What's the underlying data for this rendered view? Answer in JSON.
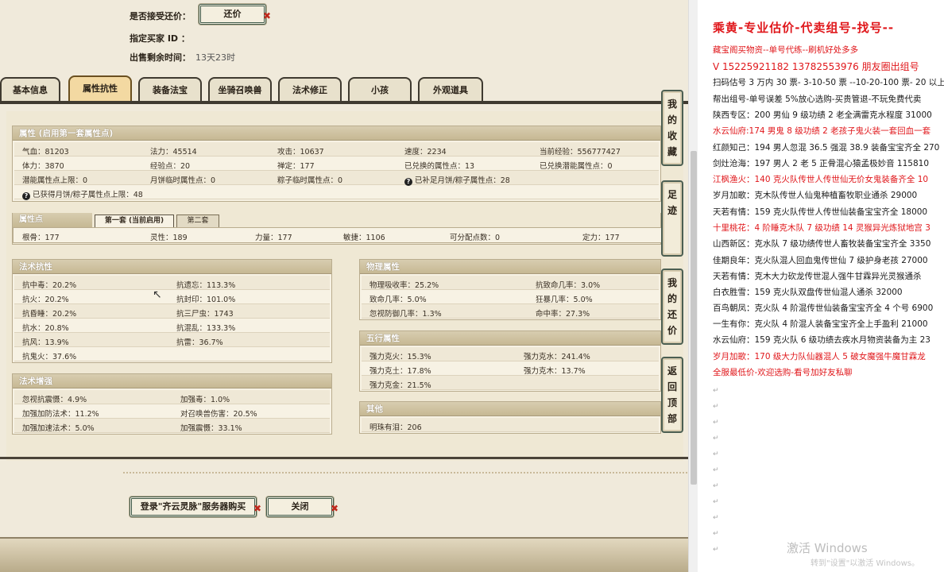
{
  "top": {
    "accept_counter_label": "是否接受还价：",
    "counter_button": "还价",
    "buyer_id_label": "指定买家 ID ：",
    "time_left_label": "出售剩余时间：",
    "time_left_value": "13天23时"
  },
  "tabs": [
    "基本信息",
    "属性抗性",
    "装备法宝",
    "坐骑召唤兽",
    "法术修正",
    "小孩",
    "外观道具"
  ],
  "active_tab": 1,
  "attributes": {
    "header": "属性 (启用第一套属性点)",
    "rows": [
      [
        "气血：81203",
        "法力：45514",
        "攻击：10637",
        "速度：2234",
        "当前经验：556777427"
      ],
      [
        "体力：3870",
        "经验点：20",
        "禅定：177",
        "已兑换的属性点：13",
        "已兑换潜能属性点：0"
      ],
      [
        "潜能属性点上限：0",
        "月饼临时属性点：0",
        "粽子临时属性点：0",
        "已补足月饼/粽子属性点：28",
        ""
      ]
    ],
    "footnote": "已获得月饼/粽子属性点上限：48"
  },
  "points": {
    "header": "属性点",
    "subtabs": [
      "第一套 (当前启用)",
      "第二套"
    ],
    "items": [
      "根骨：177",
      "灵性：189",
      "力量：177",
      "敏捷：1106",
      "可分配点数：0",
      "定力：177"
    ]
  },
  "spell_resist": {
    "header": "法术抗性",
    "left": [
      "抗中毒：20.2%",
      "抗火：20.2%",
      "抗昏睡：20.2%",
      "抗水：20.8%",
      "抗风：13.9%",
      "抗鬼火：37.6%"
    ],
    "right": [
      "抗遗忘：113.3%",
      "抗封印：101.0%",
      "抗三尸虫：1743",
      "抗混乱：133.3%",
      "抗雷：36.7%"
    ]
  },
  "spell_boost": {
    "header": "法术增强",
    "left": [
      "忽视抗震慑：4.9%",
      "加强加防法术：11.2%",
      "加强加速法术：5.0%"
    ],
    "right": [
      "加强毒：1.0%",
      "对召唤兽伤害：20.5%",
      "加强震慑：33.1%"
    ]
  },
  "physical": {
    "header": "物理属性",
    "left": [
      "物理吸收率：25.2%",
      "致命几率：5.0%",
      "忽视防御几率：1.3%"
    ],
    "right": [
      "抗致命几率：3.0%",
      "狂暴几率：5.0%",
      "命中率：27.3%"
    ]
  },
  "five_elements": {
    "header": "五行属性",
    "left": [
      "强力克火：15.3%",
      "强力克土：17.8%",
      "强力克金：21.5%"
    ],
    "right": [
      "强力克水：241.4%",
      "强力克木：13.7%"
    ]
  },
  "other": {
    "header": "其他",
    "items": [
      "明珠有泪：206"
    ]
  },
  "side_buttons": [
    "我的收藏",
    "足迹",
    "我的还价",
    "返回顶部"
  ],
  "bottom": {
    "buy_button": "登录\"齐云灵脉\"服务器购买",
    "close_button": "关闭"
  },
  "doc": {
    "lines": [
      {
        "text": "乘黄-专业估价-代卖组号-找号--",
        "style": "title"
      },
      {
        "text": "藏宝阁买物资--单号代练--刷机好处多多",
        "style": "red"
      },
      {
        "text": "V 15225921182   13782553976 朋友圈出组号",
        "style": "big"
      },
      {
        "text": "扫码估号 3 万内 30 票- 3-10-50 票  --10-20-100 票- 20 以上",
        "style": ""
      },
      {
        "text": "帮出组号-单号误差 5%放心选购-买贵管退-不玩免费代卖",
        "style": ""
      },
      {
        "text": "陕西专区：200 男仙 9 级功绩 2 老全满雷克水程度 31000",
        "style": ""
      },
      {
        "text": "水云仙府:174 男鬼 8 级功绩 2 老孩子鬼火装一套回血一套",
        "style": "red"
      },
      {
        "text": "红颜知己：194 男人忽混 36.5 强混 38.9 装备宝宝齐全 270",
        "style": ""
      },
      {
        "text": "剑灶沧海：197 男人 2 老 5 正骨混心猿孟极妙音 115810",
        "style": ""
      },
      {
        "text": "江枫渔火：140 克火队传世人传世仙无价女鬼装备齐全 10",
        "style": "red"
      },
      {
        "text": "岁月加歌：克木队传世人仙鬼种植畜牧职业通杀 29000",
        "style": ""
      },
      {
        "text": "天若有情：159 克火队传世人传世仙装备宝宝齐全 18000",
        "style": ""
      },
      {
        "text": "十里桃花：4 阶睡克木队 7 级功绩 14 灵猴异光炼狱地宫 3",
        "style": "red"
      },
      {
        "text": "山西新区：克水队 7 级功绩传世人畜牧装备宝宝齐全 3350",
        "style": ""
      },
      {
        "text": "佳期良年：克火队混人回血鬼传世仙 7 级护身老孩 27000",
        "style": ""
      },
      {
        "text": "天若有情：克木大力砍龙传世混人强牛甘霖异光灵猴通杀",
        "style": ""
      },
      {
        "text": "白衣胜雪：159 克火队双盘传世仙混人通杀 32000",
        "style": ""
      },
      {
        "text": "百鸟朝凤：克火队 4 阶混传世仙装备宝宝齐全 4 个号 6900",
        "style": ""
      },
      {
        "text": "一生有你：克火队 4 阶混人装备宝宝齐全上手盈利 21000",
        "style": ""
      },
      {
        "text": "水云仙府：159 克火队 6 级功绩去疾水月物资装备为主 23",
        "style": ""
      },
      {
        "text": "岁月加歌：170 级大力队仙器混人 5 破女魔强牛魔甘霖龙",
        "style": "red"
      },
      {
        "text": "全服最低价-欢迎选购-看号加好友私聊",
        "style": "red"
      }
    ],
    "watermark": "激活 Windows",
    "watermark_sub": "转到\"设置\"以激活 Windows。"
  },
  "colors": {
    "accent_red": "#e0171b",
    "panel_bg": "#f0eadb",
    "header_bg": "#c6b893",
    "frame": "#3f5a4a"
  }
}
